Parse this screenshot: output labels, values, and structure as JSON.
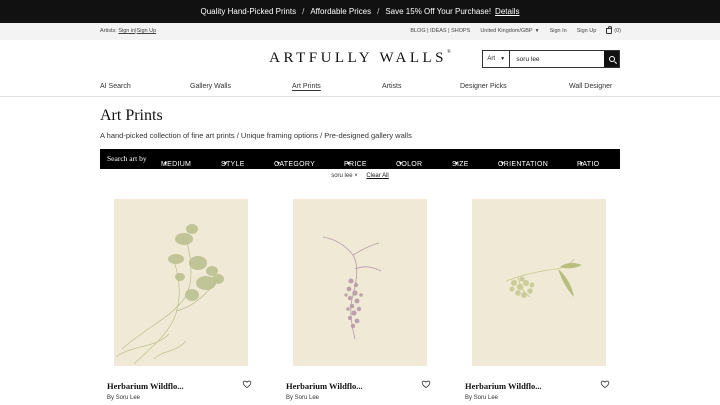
{
  "promo": {
    "item1": "Quality Hand-Picked Prints",
    "sep": "/",
    "item2": "Affordable Prices",
    "item3": "Save 15% Off Your Purchase!",
    "details_link": "Details"
  },
  "util": {
    "artists_label": "Artists:",
    "sign_in": "Sign in",
    "pipe": "|",
    "sign_up": "Sign Up",
    "blog_links": "BLOG | IDEAS | SHOPS",
    "locale": "United Kingdom/GBP",
    "sign_in_right": "Sign In",
    "sign_up_right": "Sign Up",
    "cart_count": "(0)"
  },
  "logo": {
    "text": "ARTFULLY WALLS",
    "mark": "®"
  },
  "search": {
    "category": "Art",
    "value": "soru lee"
  },
  "nav": [
    "AI Search",
    "Gallery Walls",
    "Art Prints",
    "Artists",
    "Designer Picks",
    "Wall Designer"
  ],
  "page": {
    "title": "Art Prints",
    "subtitle": "A hand-picked collection of fine art prints  /  Unique framing options  /  Pre-designed gallery walls"
  },
  "filters": {
    "label": "Search art by",
    "items": [
      "MEDIUM",
      "STYLE",
      "CATEGORY",
      "PRICE",
      "COLOR",
      "SIZE",
      "ORIENTATION",
      "RATIO"
    ]
  },
  "active_filters": {
    "chip": "soru lee ×",
    "clear": "Clear All"
  },
  "products": [
    {
      "name": "Herbarium Wildflo...",
      "artist": "By Soru Lee",
      "plant_color": "#b9be8c"
    },
    {
      "name": "Herbarium Wildflo...",
      "artist": "By Soru Lee",
      "plant_color": "#b59aa7"
    },
    {
      "name": "Herbarium Wildflo...",
      "artist": "By Soru Lee",
      "plant_color": "#c5c98f"
    }
  ],
  "colors": {
    "promo_bg": "#111111",
    "filter_bg": "#000000",
    "paper": "#f0e9d6"
  }
}
